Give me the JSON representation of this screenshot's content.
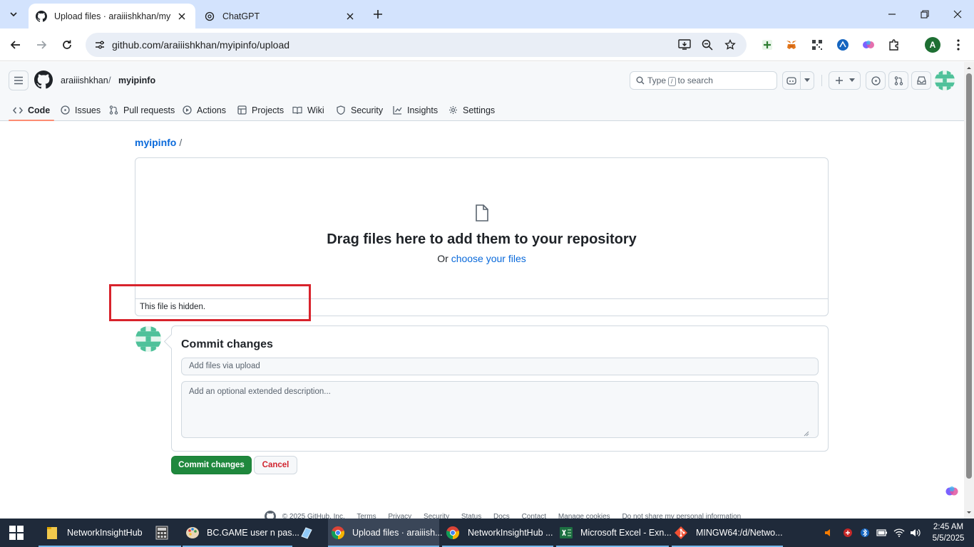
{
  "browser": {
    "tabs": [
      {
        "title": "Upload files · araiiishkhan/myipinfo",
        "active": true,
        "favicon": "github-icon"
      },
      {
        "title": "ChatGPT",
        "active": false,
        "favicon": "chatgpt-icon"
      }
    ],
    "url": "github.com/araiiishkhan/myipinfo/upload",
    "profile_initial": "A"
  },
  "github": {
    "owner": "araiiishkhan",
    "repo": "myipinfo",
    "search": {
      "prefix": "Type",
      "key": "/",
      "suffix": "to search"
    },
    "nav": [
      {
        "label": "Code",
        "icon": "code-icon",
        "selected": true
      },
      {
        "label": "Issues",
        "icon": "issues-icon"
      },
      {
        "label": "Pull requests",
        "icon": "pull-request-icon"
      },
      {
        "label": "Actions",
        "icon": "actions-icon"
      },
      {
        "label": "Projects",
        "icon": "projects-icon"
      },
      {
        "label": "Wiki",
        "icon": "wiki-icon"
      },
      {
        "label": "Security",
        "icon": "shield-icon"
      },
      {
        "label": "Insights",
        "icon": "graph-icon"
      },
      {
        "label": "Settings",
        "icon": "gear-icon"
      }
    ]
  },
  "upload": {
    "breadcrumb_repo": "myipinfo",
    "breadcrumb_sep": "/",
    "drop_title": "Drag files here to add them to your repository",
    "drop_prefix": "Or",
    "drop_link": "choose your files",
    "hidden_file_notice": "This file is hidden."
  },
  "commit": {
    "title": "Commit changes",
    "summary_placeholder": "Add files via upload",
    "description_placeholder": "Add an optional extended description...",
    "commit_button": "Commit changes",
    "cancel_button": "Cancel"
  },
  "footer": {
    "items": [
      "© 2025 GitHub, Inc.",
      "Terms",
      "Privacy",
      "Security",
      "Status",
      "Docs",
      "Contact",
      "Manage cookies",
      "Do not share my personal information"
    ]
  },
  "taskbar": {
    "items": [
      {
        "label": "NetworkInsightHub",
        "icon": "folder-icon"
      },
      {
        "label": "",
        "icon": "calculator-icon"
      },
      {
        "label": "BC.GAME user n pas...",
        "icon": "paint-icon"
      },
      {
        "label": "",
        "icon": "app-icon"
      },
      {
        "label": "Upload files · araiiish...",
        "icon": "chrome-icon",
        "active": true
      },
      {
        "label": "NetworkInsightHub ...",
        "icon": "chrome-icon"
      },
      {
        "label": "Microsoft Excel - Exn...",
        "icon": "excel-icon"
      },
      {
        "label": "MINGW64:/d/Netwo...",
        "icon": "git-icon"
      }
    ],
    "time": "2:45 AM",
    "date": "5/5/2025"
  },
  "colors": {
    "accent_blue": "#0969da",
    "commit_green": "#1f883d",
    "highlight_red": "#d8232c",
    "tab_strip": "#d3e3fd",
    "taskbar": "#1f2a3a"
  }
}
